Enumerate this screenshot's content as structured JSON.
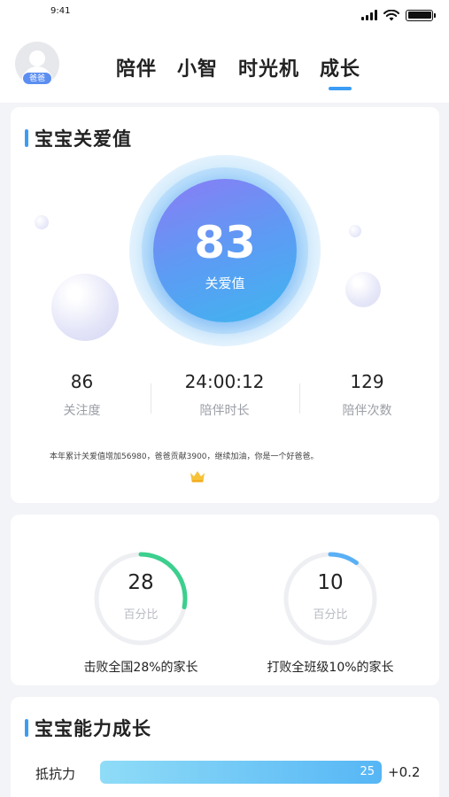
{
  "status_bar": {
    "time": "9:41"
  },
  "header": {
    "avatar_badge": "爸爸",
    "tabs": [
      {
        "label": "陪伴",
        "active": false
      },
      {
        "label": "小智",
        "active": false
      },
      {
        "label": "时光机",
        "active": false
      },
      {
        "label": "成长",
        "active": true
      }
    ]
  },
  "care_card": {
    "title": "宝宝关爱值",
    "score": "83",
    "score_label": "关爱值",
    "stats": [
      {
        "value": "86",
        "label": "关注度"
      },
      {
        "value": "24:00:12",
        "label": "陪伴时长"
      },
      {
        "value": "129",
        "label": "陪伴次数"
      }
    ],
    "note": "本年累计关爱值增加56980，爸爸贡献3900，继续加油，你是一个好爸爸。",
    "note_icon": "crown-icon"
  },
  "rank_card": {
    "rings": [
      {
        "value": "28",
        "label": "百分比",
        "caption": "击败全国28%的家长",
        "percent": 28,
        "color": "#3ccf8e"
      },
      {
        "value": "10",
        "label": "百分比",
        "caption": "打败全班级10%的家长",
        "percent": 10,
        "color": "#5ab0f5"
      }
    ]
  },
  "ability_card": {
    "title": "宝宝能力成长",
    "items": [
      {
        "name": "抵抗力",
        "value": "25",
        "delta": "+0.2",
        "fill_fraction": 1.0
      }
    ]
  },
  "colors": {
    "accent": "#3b9cf5",
    "green": "#3ccf8e",
    "blue": "#5ab0f5"
  }
}
